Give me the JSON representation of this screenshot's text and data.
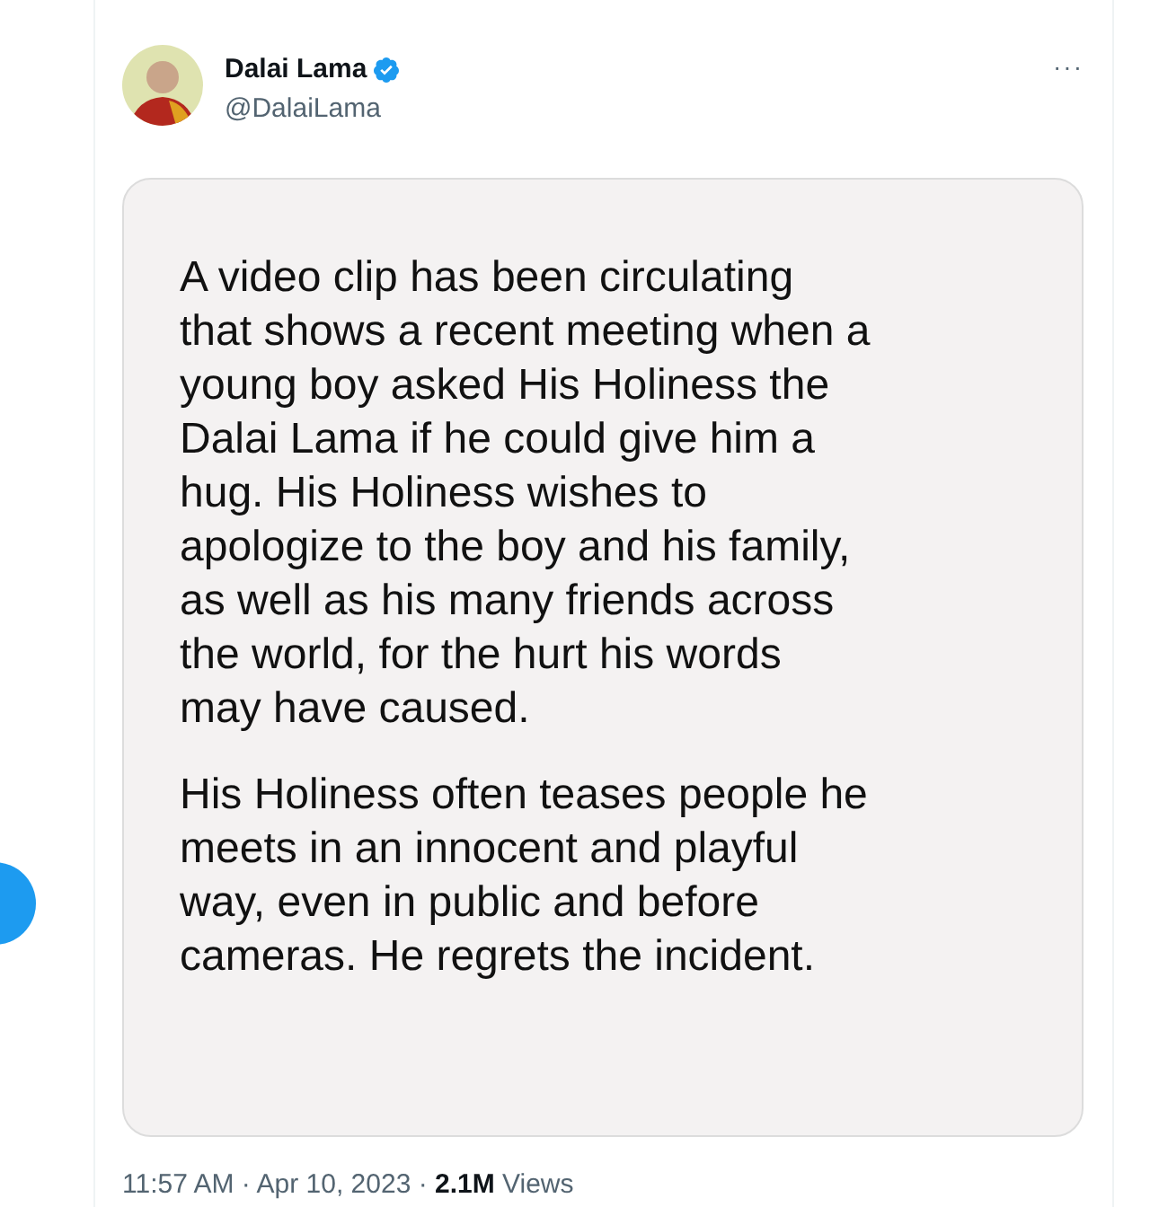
{
  "author": {
    "name": "Dalai Lama",
    "verified": true,
    "handle": "@DalaiLama"
  },
  "menu": {
    "label": "···"
  },
  "statement_image": {
    "paragraphs": [
      [
        "A video clip has been circulating",
        "that shows a recent meeting when a",
        "young boy asked His Holiness the",
        "Dalai Lama if he could give him a",
        "hug. His Holiness wishes to",
        "apologize to the boy and his family,",
        "as well as his many friends across",
        "the world, for the hurt his words",
        "may have caused."
      ],
      [
        "His Holiness often teases people he",
        "meets in an innocent and playful",
        "way, even in public and before",
        "cameras. He regrets the incident."
      ]
    ]
  },
  "meta": "11:57 AM · Apr 10, 2023 · **2.1M** Views"
}
